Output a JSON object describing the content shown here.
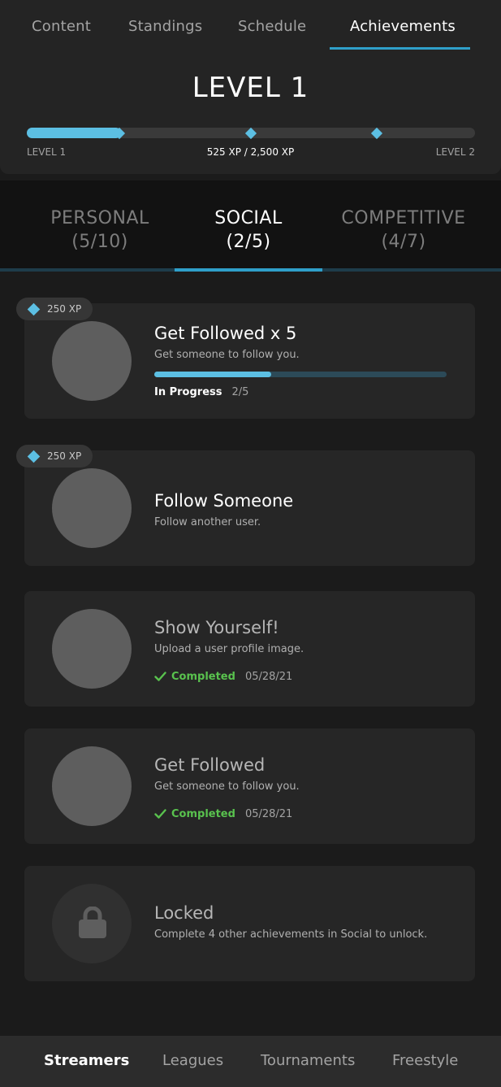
{
  "top_tabs": [
    {
      "label": "Content"
    },
    {
      "label": "Standings"
    },
    {
      "label": "Schedule"
    },
    {
      "label": "Achievements",
      "active": true
    }
  ],
  "level": {
    "title": "LEVEL 1",
    "start_label": "LEVEL 1",
    "end_label": "LEVEL 2",
    "xp_text": "525 XP / 2,500 XP",
    "progress_fraction": 0.21
  },
  "categories": [
    {
      "name": "PERSONAL",
      "count": "(5/10)"
    },
    {
      "name": "SOCIAL",
      "count": "(2/5)",
      "active": true
    },
    {
      "name": "COMPETITIVE",
      "count": "(4/7)"
    }
  ],
  "achievements": [
    {
      "xp_badge": "250 XP",
      "title": "Get Followed x 5",
      "description": "Get someone to follow you.",
      "status_label": "In Progress",
      "status_value": "2/5",
      "progress_fraction": 0.4
    },
    {
      "xp_badge": "250 XP",
      "title": "Follow Someone",
      "description": "Follow another user."
    },
    {
      "title": "Show Yourself!",
      "description": "Upload a user profile image.",
      "status_label": "Completed",
      "status_value": "05/28/21"
    },
    {
      "title": "Get Followed",
      "description": "Get someone to follow you.",
      "status_label": "Completed",
      "status_value": "05/28/21"
    },
    {
      "title": "Locked",
      "description": "Complete 4 other achievements in Social to unlock.",
      "icon": "lock-icon"
    }
  ],
  "bottom_nav": [
    {
      "label": "Streamers",
      "active": true
    },
    {
      "label": "Leagues"
    },
    {
      "label": "Tournaments"
    },
    {
      "label": "Freestyle"
    }
  ],
  "colors": {
    "accent": "#5cbfe3",
    "completed": "#59c24e",
    "background": "#1b1b1b",
    "card": "#262626"
  }
}
